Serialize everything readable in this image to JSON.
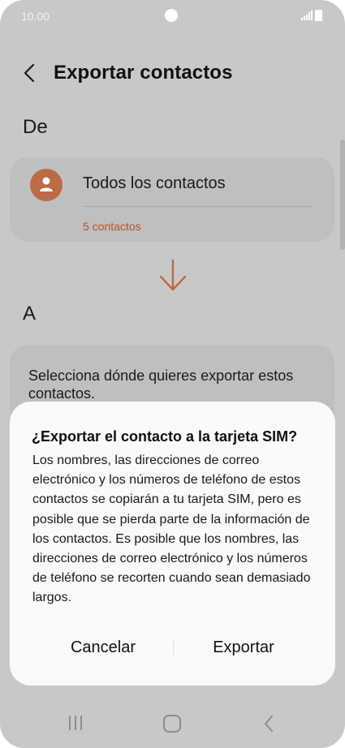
{
  "status_bar": {
    "time": "10.00"
  },
  "header": {
    "title": "Exportar contactos"
  },
  "from_section": {
    "label": "De",
    "source": "Todos los contactos",
    "count": "5 contactos"
  },
  "to_section": {
    "label": "A",
    "prompt": "Selecciona dónde quieres exportar estos contactos."
  },
  "dialog": {
    "title": "¿Exportar el contacto a la tarjeta SIM?",
    "body": "Los nombres, las direcciones de correo electrónico y los números de teléfono de estos contactos se copiarán a tu tarjeta SIM, pero es posible que se pierda parte de la información de los contactos. Es posible que los nombres, las direcciones de correo electrónico y los números de teléfono se recorten cuando sean demasiado largos.",
    "cancel_label": "Cancelar",
    "confirm_label": "Exportar"
  },
  "icons": {
    "back": "back-arrow-icon",
    "avatar": "person-icon",
    "arrow": "arrow-down-icon",
    "nav_recents": "recents-icon",
    "nav_home": "home-icon",
    "nav_back": "nav-back-icon"
  },
  "colors": {
    "accent": "#bd6a47",
    "accent_text": "#b4542c",
    "dim_background": "#c8c8c8",
    "dialog_background": "#fafafa"
  }
}
